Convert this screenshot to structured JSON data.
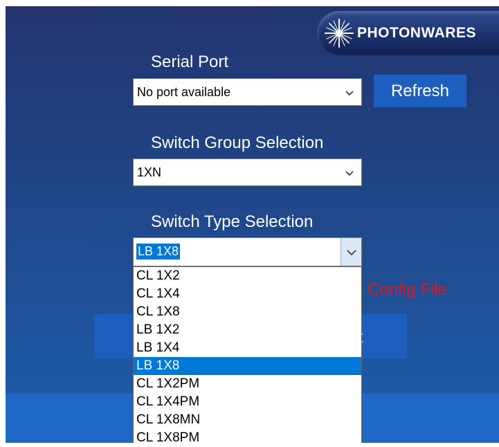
{
  "logo": {
    "text": "PHOTONWARES"
  },
  "serial_port": {
    "label": "Serial Port",
    "value": "No port available",
    "refresh_label": "Refresh"
  },
  "switch_group": {
    "label": "Switch Group Selection",
    "value": "1XN"
  },
  "switch_type": {
    "label": "Switch Type Selection",
    "value": "LB 1X8",
    "options": [
      "CL 1X2",
      "CL 1X4",
      "CL 1X8",
      "LB 1X2",
      "LB 1X4",
      "LB 1X8",
      "CL 1X2PM",
      "CL 1X4PM",
      "CL 1X8MN",
      "CL 1X8PM"
    ],
    "selected_index": 5
  },
  "config_file_text": "Config File",
  "connect_label_partial": "ct",
  "colors": {
    "panel_top": "#22346f",
    "panel_bottom": "#1b5eb0",
    "button": "#1d5fbf",
    "selection": "#0078d7",
    "warning_text": "#e51414"
  }
}
